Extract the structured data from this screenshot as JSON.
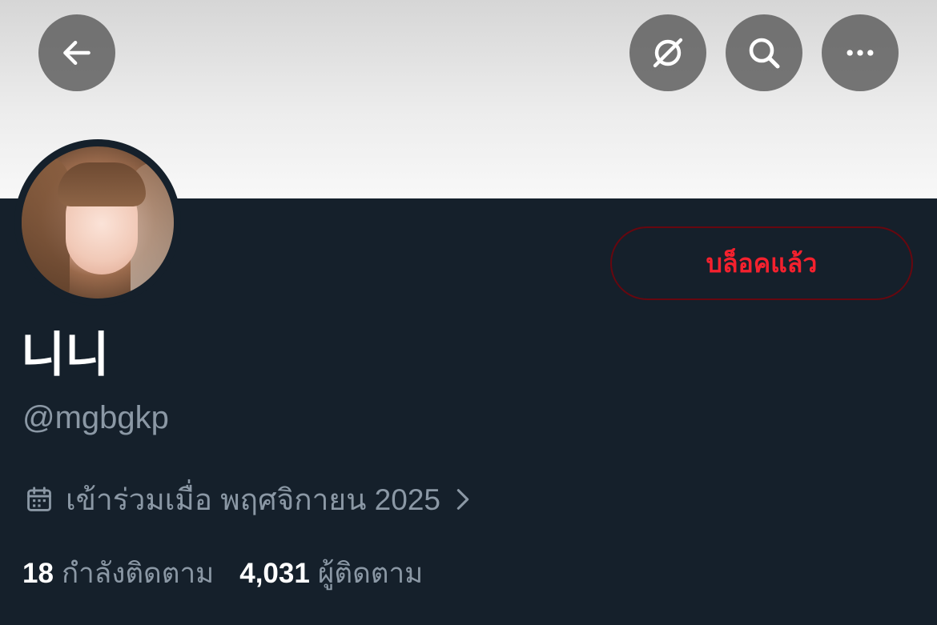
{
  "header": {
    "back_icon": "arrow-left-icon",
    "grok_icon": "slashed-circle-icon",
    "search_icon": "search-icon",
    "more_icon": "ellipsis-icon"
  },
  "profile": {
    "display_name": "니니",
    "handle": "@mgbgkp",
    "block_button_label": "บล็อคแล้ว",
    "joined_text": "เข้าร่วมเมื่อ พฤศจิกายน 2025",
    "following_count": "18",
    "following_label": "กำลังติดตาม",
    "followers_count": "4,031",
    "followers_label": "ผู้ติดตาม"
  },
  "colors": {
    "background": "#15202b",
    "secondary_text": "#8b98a5",
    "danger": "#f4212e",
    "danger_border": "#67070f"
  }
}
